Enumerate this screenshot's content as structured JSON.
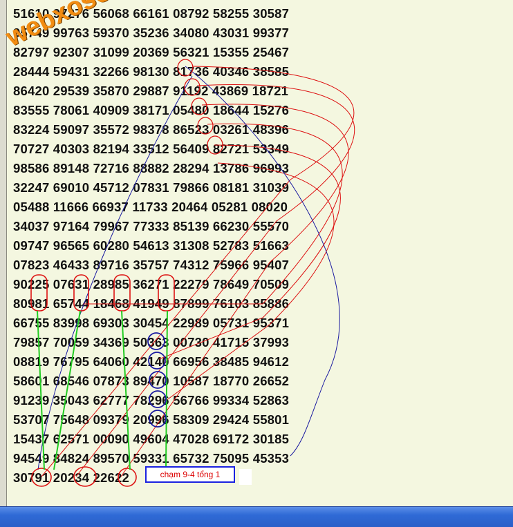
{
  "rows": [
    "51610 97276 56068 66161 08792 58255 30587",
    "95749 99763 59370 35236 34080 43031 99377",
    "82797 92307 31099 20369 56321 15355 25467",
    "28444 59431 32266 98130 81736 40346 38585",
    "86420 29539 35870 29887 91192 43869 18721",
    "83555 78061 40909 38171 05480 18644 15276",
    "83224 59097 35572 98378 86523 03261 48396",
    "70727 40303 82194 33512 56409 82721 53349",
    "98586 89148 72716 88882 28294 13786 96993",
    "32247 69010 45712 07831 79866 08181 31039",
    "05488 11666 66937 11733 20464 05281 08020",
    "34037 97164 79967 77333 85139 66230 55570",
    "09747 96565 60280 54613 31308 52783 51663",
    "07823 46433 89716 35757 74312 75966 95407",
    "90225 07631 28985 36271 22279 78649 70509",
    "80981 65744 18468 41949 87899 76103 85886",
    "66755 83998 69303 30454 22989 05731 95371",
    "79857 70059 34369 50363 00730 41715 37993",
    "08819 76795 64060 42140 66956 38485 94612",
    "58601 68546 07873 89470 10587 18770 26652",
    "91239 35043 62777 78296 56766 99334 52863",
    "53707 75648 09379 20996 58309 29424 55801",
    "15437 62571 00090 49604 47028 69172 30185",
    "94549 84824 89570 59331 65732 75095 45353",
    "30791 20234 22622"
  ],
  "watermark": "webxoso.net",
  "note": "chạm 9-4 tổng 1",
  "colors": {
    "background": "#f4f7e0",
    "digits": "#111111",
    "red_marks": "#dd1111",
    "blue_marks": "#1a1aa0",
    "green_lines": "#22cc22",
    "watermark": "#f28c12",
    "taskbar": "#2f6ad6"
  }
}
